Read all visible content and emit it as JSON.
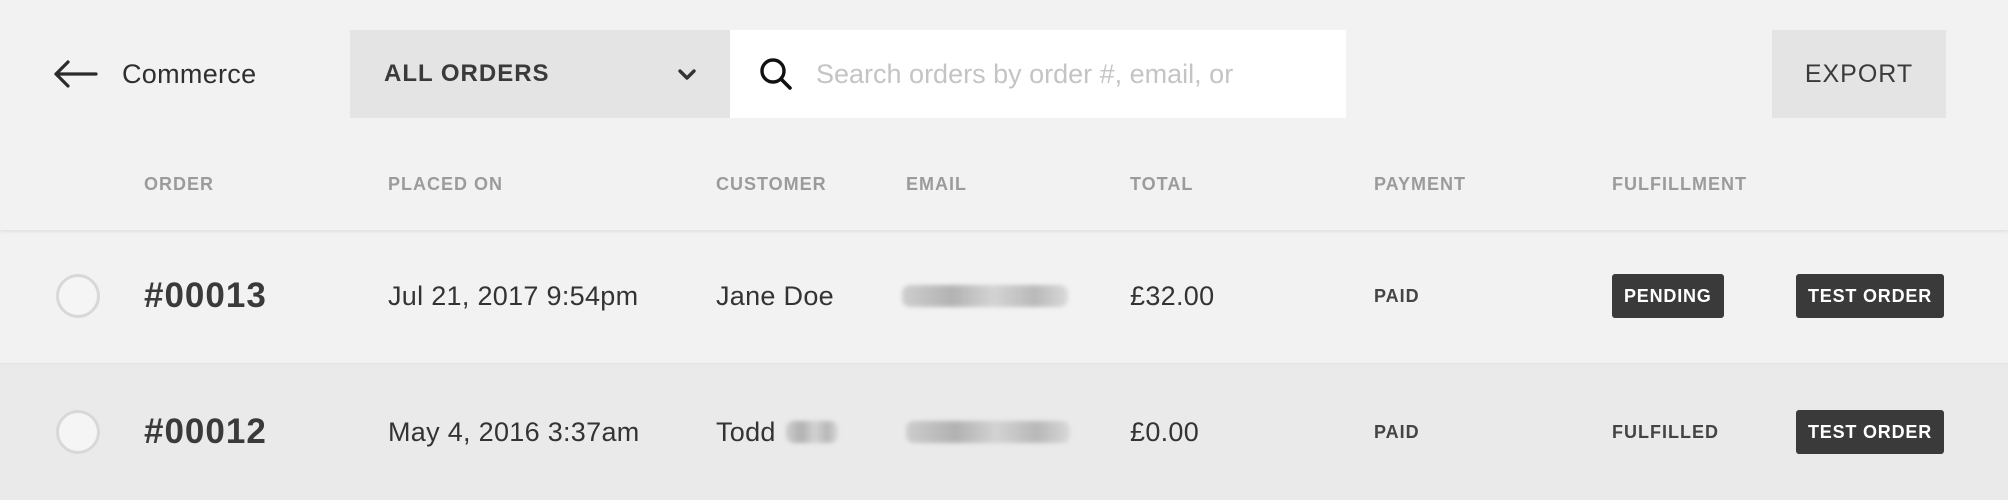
{
  "header": {
    "back_label": "Commerce",
    "filter_label": "ALL ORDERS",
    "search_placeholder": "Search orders by order #, email, or",
    "export_label": "EXPORT"
  },
  "columns": [
    "ORDER",
    "PLACED ON",
    "CUSTOMER",
    "EMAIL",
    "TOTAL",
    "PAYMENT",
    "FULFILLMENT"
  ],
  "orders": [
    {
      "number": "#00013",
      "placed_on": "Jul 21, 2017 9:54pm",
      "customer": "Jane Doe",
      "total": "£32.00",
      "payment": "PAID",
      "fulfillment": "PENDING",
      "tag": "TEST ORDER"
    },
    {
      "number": "#00012",
      "placed_on": "May 4, 2016 3:37am",
      "customer": "Todd",
      "total": "£0.00",
      "payment": "PAID",
      "fulfillment": "FULFILLED",
      "tag": "TEST ORDER"
    }
  ],
  "icons": {
    "back": "arrow-left-icon",
    "filter": "chevron-down-icon",
    "search": "search-icon"
  }
}
